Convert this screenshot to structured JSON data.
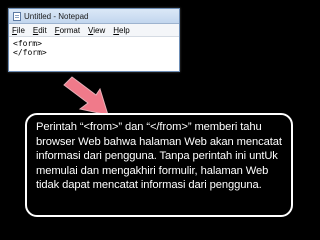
{
  "window": {
    "title": "Untitled - Notepad",
    "menu": [
      "File",
      "Edit",
      "Format",
      "View",
      "Help"
    ],
    "editor_lines": [
      "<form>",
      "</form>"
    ]
  },
  "caption": {
    "text": "Perintah “<from>” dan “</from>” memberi tahu browser Web bahwa halaman Web akan mencatat informasi dari pengguna. Tanpa perintah ini untUk memulai dan mengakhiri formulir, halaman Web tidak dapat mencatat informasi dari pengguna."
  },
  "colors": {
    "background": "#000000",
    "arrow": "#f07a8a",
    "caption_text": "#ffffff"
  },
  "icons": [
    "notepad-app-icon",
    "down-right-arrow-icon"
  ]
}
